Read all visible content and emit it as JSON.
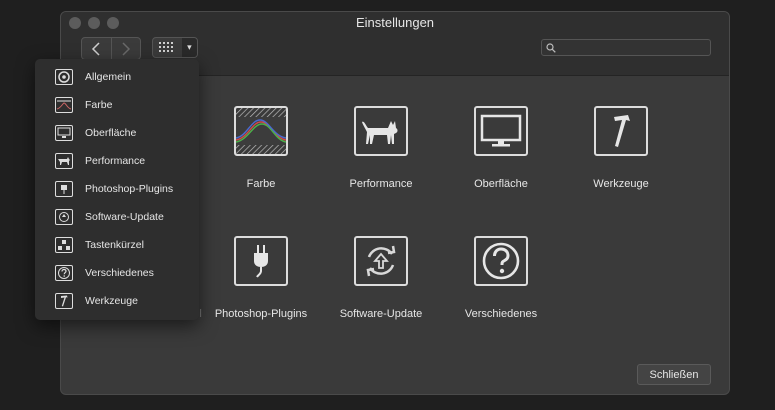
{
  "window": {
    "title": "Einstellungen"
  },
  "toolbar": {
    "back_icon": "chevron-left-icon",
    "forward_icon": "chevron-right-icon",
    "grid_icon": "grid-icon",
    "dropdown_arrow": "▾",
    "search_placeholder": ""
  },
  "grid_items": [
    {
      "label": "Farbe",
      "icon": "color-gradient-icon"
    },
    {
      "label": "Performance",
      "icon": "cat-icon"
    },
    {
      "label": "Oberfläche",
      "icon": "monitor-icon"
    },
    {
      "label": "Werkzeuge",
      "icon": "hammer-icon"
    },
    {
      "label": "Photoshop-Plugins",
      "icon": "plug-icon"
    },
    {
      "label": "Software-Update",
      "icon": "update-icon"
    },
    {
      "label": "Verschiedenes",
      "icon": "question-icon"
    }
  ],
  "menu": {
    "items": [
      {
        "label": "Allgemein",
        "icon": "general-icon"
      },
      {
        "label": "Farbe",
        "icon": "color-icon"
      },
      {
        "label": "Oberfläche",
        "icon": "monitor-icon"
      },
      {
        "label": "Performance",
        "icon": "cat-icon"
      },
      {
        "label": "Photoshop-Plugins",
        "icon": "plug-icon"
      },
      {
        "label": "Software-Update",
        "icon": "update-icon"
      },
      {
        "label": "Tastenkürzel",
        "icon": "keyboard-icon"
      },
      {
        "label": "Verschiedenes",
        "icon": "question-icon"
      },
      {
        "label": "Werkzeuge",
        "icon": "hammer-icon"
      }
    ]
  },
  "ghost_label": "Tastenkürzel",
  "footer": {
    "close_label": "Schließen"
  },
  "colors": {
    "window_bg": "#3a3a3a",
    "titlebar_bg": "#2f2f2f",
    "menu_bg": "#2e2e2e",
    "text": "#e6e6e6"
  }
}
